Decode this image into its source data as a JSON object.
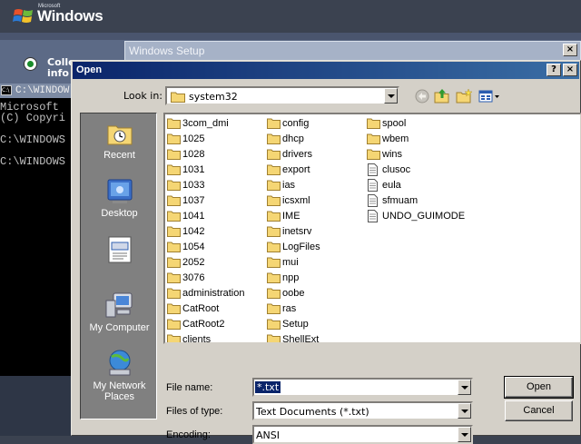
{
  "desktop": {
    "logo_brand": "Microsoft",
    "logo_text": "Windows",
    "setup_title": "Windows Setup",
    "setup_close": "×",
    "collect_text": "Colle",
    "info_text": "info",
    "cmd_title": "C:\\WINDOW",
    "cmd_lines": [
      "Microsoft",
      "(C) Copyri",
      "C:\\WINDOWS",
      "C:\\WINDOWS"
    ]
  },
  "dialog": {
    "title": "Open",
    "help_label": "?",
    "close_label": "×",
    "look_in_label": "Look in:",
    "look_in_value": "system32",
    "places": [
      {
        "label": "Recent",
        "icon": "recent-folder-icon"
      },
      {
        "label": "Desktop",
        "icon": "desktop-icon"
      },
      {
        "label": "",
        "icon": "my-documents-icon"
      },
      {
        "label": "My Computer",
        "icon": "my-computer-icon"
      },
      {
        "label": "My Network Places",
        "icon": "network-places-icon"
      }
    ],
    "files": {
      "col1": [
        "3com_dmi",
        "1025",
        "1028",
        "1031",
        "1033",
        "1037",
        "1041",
        "1042",
        "1054",
        "2052",
        "3076",
        "administration",
        "CatRoot",
        "CatRoot2",
        "clients"
      ],
      "col2": [
        "config",
        "dhcp",
        "drivers",
        "export",
        "ias",
        "icsxml",
        "IME",
        "inetsrv",
        "LogFiles",
        "mui",
        "npp",
        "oobe",
        "ras",
        "Setup",
        "ShellExt"
      ],
      "col3_folders": [
        "spool",
        "wbem",
        "wins"
      ],
      "col3_files": [
        "clusoc",
        "eula",
        "sfmuam",
        "UNDO_GUIMODE"
      ]
    },
    "file_name_label": "File name:",
    "file_name_value": "*.txt",
    "files_of_type_label": "Files of type:",
    "files_of_type_value": "Text Documents (*.txt)",
    "encoding_label": "Encoding:",
    "encoding_value": "ANSI",
    "open_button": "Open",
    "cancel_button": "Cancel"
  },
  "colors": {
    "title_bar": "#0a246a",
    "dialog_face": "#d4d0c8",
    "folder_yellow": "#f5d674"
  }
}
